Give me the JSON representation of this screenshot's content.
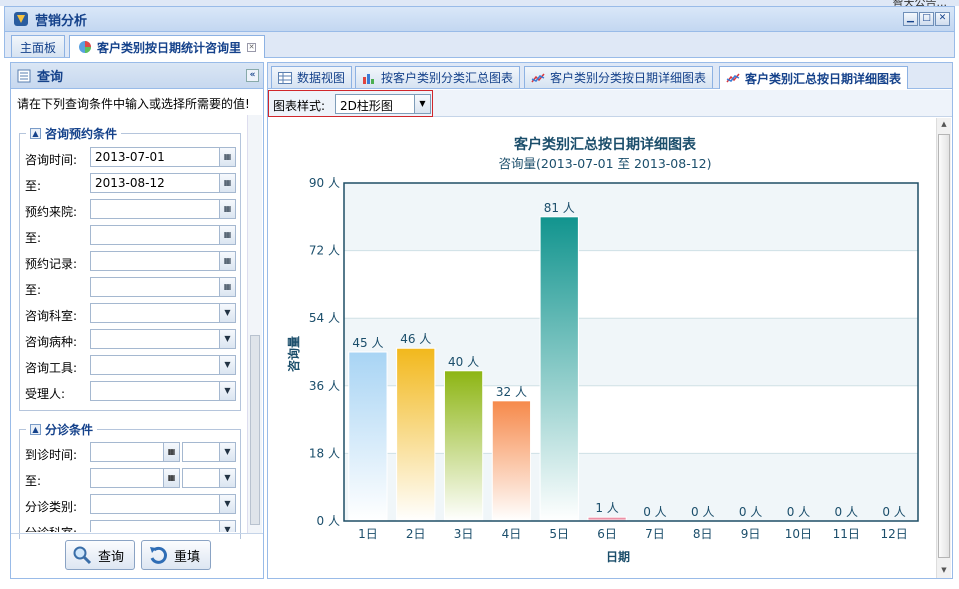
{
  "top_strip": {
    "notice": "智天公告..."
  },
  "window": {
    "title": "营销分析",
    "buttons": [
      "minimize",
      "maximize",
      "close"
    ]
  },
  "main_tabs": [
    {
      "label": "主面板",
      "active": false
    },
    {
      "label": "客户类别按日期统计咨询里",
      "active": true,
      "closable": true
    }
  ],
  "query_panel": {
    "title": "查询",
    "instruction": "请在下列查询条件中输入或选择所需要的值!",
    "sections": [
      {
        "legend": "咨询预约条件",
        "fields": [
          {
            "label": "咨询时间:",
            "value": "2013-07-01",
            "kind": "date"
          },
          {
            "label": "至:",
            "value": "2013-08-12",
            "kind": "date"
          },
          {
            "label": "预约来院:",
            "value": "",
            "kind": "date"
          },
          {
            "label": "至:",
            "value": "",
            "kind": "date"
          },
          {
            "label": "预约记录:",
            "value": "",
            "kind": "date"
          },
          {
            "label": "至:",
            "value": "",
            "kind": "date"
          },
          {
            "label": "咨询科室:",
            "value": "",
            "kind": "select"
          },
          {
            "label": "咨询病种:",
            "value": "",
            "kind": "select"
          },
          {
            "label": "咨询工具:",
            "value": "",
            "kind": "select"
          },
          {
            "label": "受理人:",
            "value": "",
            "kind": "select"
          }
        ]
      },
      {
        "legend": "分诊条件",
        "fields": [
          {
            "label": "到诊时间:",
            "value": "",
            "kind": "datetime"
          },
          {
            "label": "至:",
            "value": "",
            "kind": "datetime"
          },
          {
            "label": "分诊类别:",
            "value": "",
            "kind": "select"
          },
          {
            "label": "分诊科室:",
            "value": "",
            "kind": "select"
          }
        ]
      }
    ],
    "buttons": {
      "query": "查询",
      "reset": "重填"
    }
  },
  "report_tabs": [
    {
      "label": "数据视图",
      "icon": "grid-icon",
      "active": false
    },
    {
      "label": "按客户类别分类汇总图表",
      "icon": "bar-chart-icon",
      "active": false
    },
    {
      "label": "客户类别分类按日期详细图表",
      "icon": "line-chart-icon",
      "active": false
    },
    {
      "label": "客户类别汇总按日期详细图表",
      "icon": "line-chart-icon",
      "active": true
    }
  ],
  "toolbar": {
    "style_label": "图表样式:",
    "style_value": "2D柱形图"
  },
  "chart_data": {
    "type": "bar",
    "title": "客户类别汇总按日期详细图表",
    "subtitle": "咨询量(2013-07-01 至 2013-08-12)",
    "xlabel": "日期",
    "ylabel": "咨询量",
    "categories": [
      "1日",
      "2日",
      "3日",
      "4日",
      "5日",
      "6日",
      "7日",
      "8日",
      "9日",
      "10日",
      "11日",
      "12日"
    ],
    "values": [
      45,
      46,
      40,
      32,
      81,
      1,
      0,
      0,
      0,
      0,
      0,
      0
    ],
    "value_labels": [
      "45 人",
      "46 人",
      "40 人",
      "32 人",
      "81 人",
      "1 人",
      "0 人",
      "0 人",
      "0 人",
      "0 人",
      "0 人",
      "0 人"
    ],
    "y_ticks": [
      "0 人",
      "18 人",
      "36 人",
      "54 人",
      "72 人",
      "90 人"
    ],
    "ylim": [
      0,
      90
    ],
    "grid": true,
    "legend": "none",
    "colors": [
      "#a8d4f4",
      "#f2b81c",
      "#8db513",
      "#f6894a",
      "#11948e",
      "#e25a7a",
      "#cccccc",
      "#cccccc",
      "#cccccc",
      "#cccccc",
      "#cccccc",
      "#cccccc"
    ]
  }
}
